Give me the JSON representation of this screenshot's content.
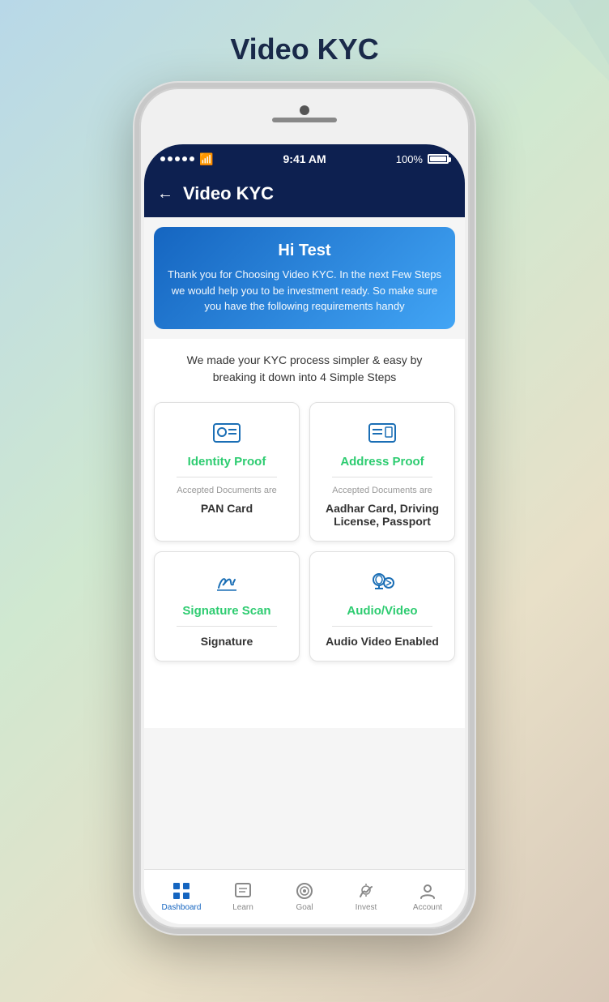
{
  "page": {
    "title": "Video KYC"
  },
  "statusBar": {
    "time": "9:41 AM",
    "battery": "100%"
  },
  "header": {
    "title": "Video KYC",
    "back_label": "←"
  },
  "greetingCard": {
    "name": "Hi Test",
    "text": "Thank you for Choosing Video KYC. In the next Few Steps we would help you to be investment ready. So make sure you have the following requirements handy"
  },
  "stepsDescription": "We made your KYC process simpler & easy by breaking it down into 4 Simple Steps",
  "cards": [
    {
      "id": "identity-proof",
      "title": "Identity Proof",
      "subtitle": "Accepted Documents are",
      "document": "PAN Card",
      "titleColor": "green"
    },
    {
      "id": "address-proof",
      "title": "Address Proof",
      "subtitle": "Accepted Documents are",
      "document": "Aadhar Card, Driving License, Passport",
      "titleColor": "green"
    },
    {
      "id": "signature-scan",
      "title": "Signature Scan",
      "subtitle": "",
      "document": "Signature",
      "titleColor": "green"
    },
    {
      "id": "audio-video",
      "title": "Audio/Video",
      "subtitle": "",
      "document": "Audio Video Enabled",
      "titleColor": "green"
    }
  ],
  "bottomNav": [
    {
      "id": "dashboard",
      "label": "Dashboard",
      "active": true
    },
    {
      "id": "learn",
      "label": "Learn",
      "active": false
    },
    {
      "id": "goal",
      "label": "Goal",
      "active": false
    },
    {
      "id": "invest",
      "label": "Invest",
      "active": false
    },
    {
      "id": "account",
      "label": "Account",
      "active": false
    }
  ]
}
